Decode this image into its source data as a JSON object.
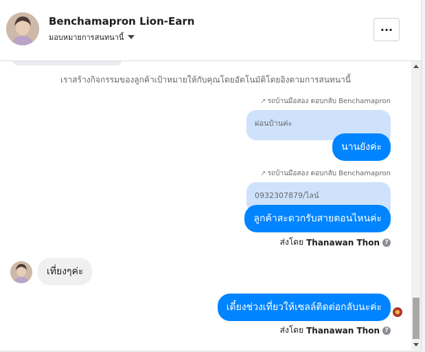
{
  "header": {
    "name": "Benchamapron Lion-Earn",
    "assign_label": "มอบหมายการสนทนานี้",
    "more_label": "···"
  },
  "chat": {
    "system_message": "เราสร้างกิจกรรมของลูกค้าเป้าหมายให้กับคุณโดยอัตโนมัติโดยอิงตามการสนทนานี้",
    "messages": [
      {
        "reply_label": "รถบ้านมือสอง ตอบกลับ Benchamapron",
        "quoted": "ผ่อนบ้านค่ะ",
        "text": "นานยังค่ะ"
      },
      {
        "reply_label": "รถบ้านมือสอง ตอบกลับ Benchamapron",
        "quoted": "0932307879/ไลน์",
        "text": "ลูกค้าสะดวกรับสายตอนไหนค่ะ"
      }
    ],
    "sent_by_prefix": "ส่งโดย",
    "sent_by_name": "Thanawan Thon",
    "incoming": {
      "text": "เที่ยงๆค่ะ"
    },
    "last_outgoing": {
      "text": "เดี๋ยงช่วงเที่ยวให้เซลล์ติดต่อกลับนะค่ะ"
    },
    "info_icon": "?"
  },
  "icons": {
    "reply": "reply-arrow-icon",
    "seen": "seen-avatar-icon"
  },
  "colors": {
    "outgoing_bubble": "#0084ff",
    "quoted_bubble": "#cfe2fb",
    "incoming_bubble": "#f1f0f0"
  }
}
